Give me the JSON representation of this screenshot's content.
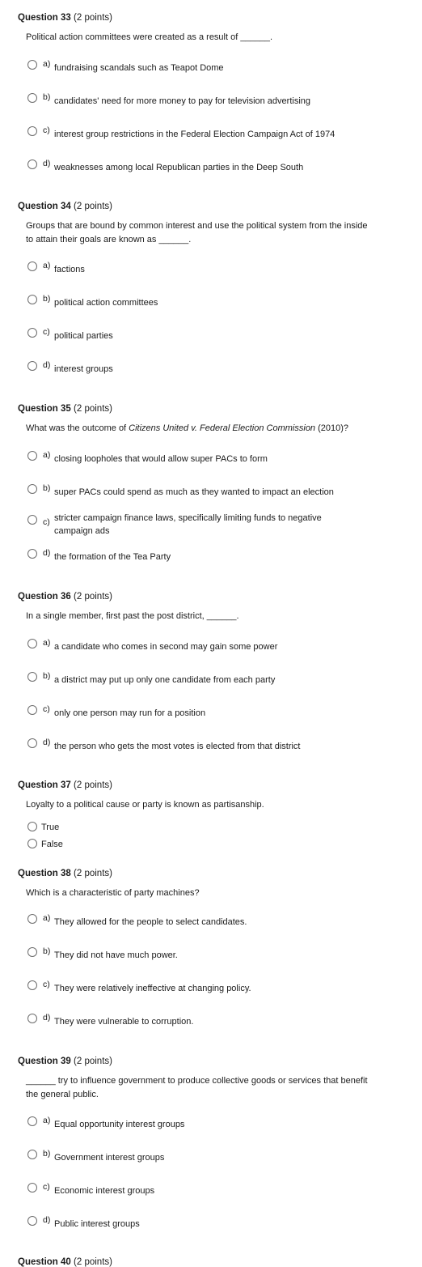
{
  "questions": [
    {
      "number": "Question 33",
      "points": "(2 points)",
      "prompt": "Political action committees were created as a result of ______.",
      "options": [
        {
          "letter": "a)",
          "text": "fundraising scandals such as Teapot Dome"
        },
        {
          "letter": "b)",
          "text": "candidates' need for more money to pay for television advertising"
        },
        {
          "letter": "c)",
          "text": "interest group restrictions in the Federal Election Campaign Act of 1974"
        },
        {
          "letter": "d)",
          "text": "weaknesses among local Republican parties in the Deep South"
        }
      ]
    },
    {
      "number": "Question 34",
      "points": "(2 points)",
      "prompt": "Groups that are bound by common interest and use the political system from the inside to attain their goals are known as ______.",
      "options": [
        {
          "letter": "a)",
          "text": "factions"
        },
        {
          "letter": "b)",
          "text": "political action committees"
        },
        {
          "letter": "c)",
          "text": "political parties"
        },
        {
          "letter": "d)",
          "text": "interest groups"
        }
      ]
    },
    {
      "number": "Question 35",
      "points": "(2 points)",
      "prompt_pre": "What was the outcome of ",
      "prompt_italic": "Citizens United v. Federal Election Commission",
      "prompt_post": " (2010)?",
      "options": [
        {
          "letter": "a)",
          "text": "closing loopholes that would allow super PACs to form"
        },
        {
          "letter": "b)",
          "text": "super PACs could spend as much as they wanted to impact an election"
        },
        {
          "letter": "c)",
          "text": "stricter campaign finance laws, specifically limiting funds to negative campaign ads"
        },
        {
          "letter": "d)",
          "text": "the formation of the Tea Party"
        }
      ]
    },
    {
      "number": "Question 36",
      "points": "(2 points)",
      "prompt": "In a single member, first past the post district, ______.",
      "options": [
        {
          "letter": "a)",
          "text": "a candidate who comes in second may gain some power"
        },
        {
          "letter": "b)",
          "text": "a district may put up only one candidate from each party"
        },
        {
          "letter": "c)",
          "text": "only one person may run for a position"
        },
        {
          "letter": "d)",
          "text": "the person who gets the most votes is elected from that district"
        }
      ]
    },
    {
      "number": "Question 37",
      "points": "(2 points)",
      "prompt": "Loyalty to a political cause or party is known as partisanship.",
      "options": [
        {
          "text": "True"
        },
        {
          "text": "False"
        }
      ]
    },
    {
      "number": "Question 38",
      "points": "(2 points)",
      "prompt": "Which is a characteristic of party machines?",
      "options": [
        {
          "letter": "a)",
          "text": "They allowed for the people to select candidates."
        },
        {
          "letter": "b)",
          "text": "They did not have much power."
        },
        {
          "letter": "c)",
          "text": "They were relatively ineffective at changing policy."
        },
        {
          "letter": "d)",
          "text": "They were vulnerable to corruption."
        }
      ]
    },
    {
      "number": "Question 39",
      "points": "(2 points)",
      "prompt": "______ try to influence government to produce collective goods or services that benefit the general public.",
      "options": [
        {
          "letter": "a)",
          "text": "Equal opportunity interest groups"
        },
        {
          "letter": "b)",
          "text": "Government interest groups"
        },
        {
          "letter": "c)",
          "text": "Economic interest groups"
        },
        {
          "letter": "d)",
          "text": "Public interest groups"
        }
      ]
    }
  ],
  "next_header": {
    "number": "Question 40",
    "points": "(2 points)"
  }
}
